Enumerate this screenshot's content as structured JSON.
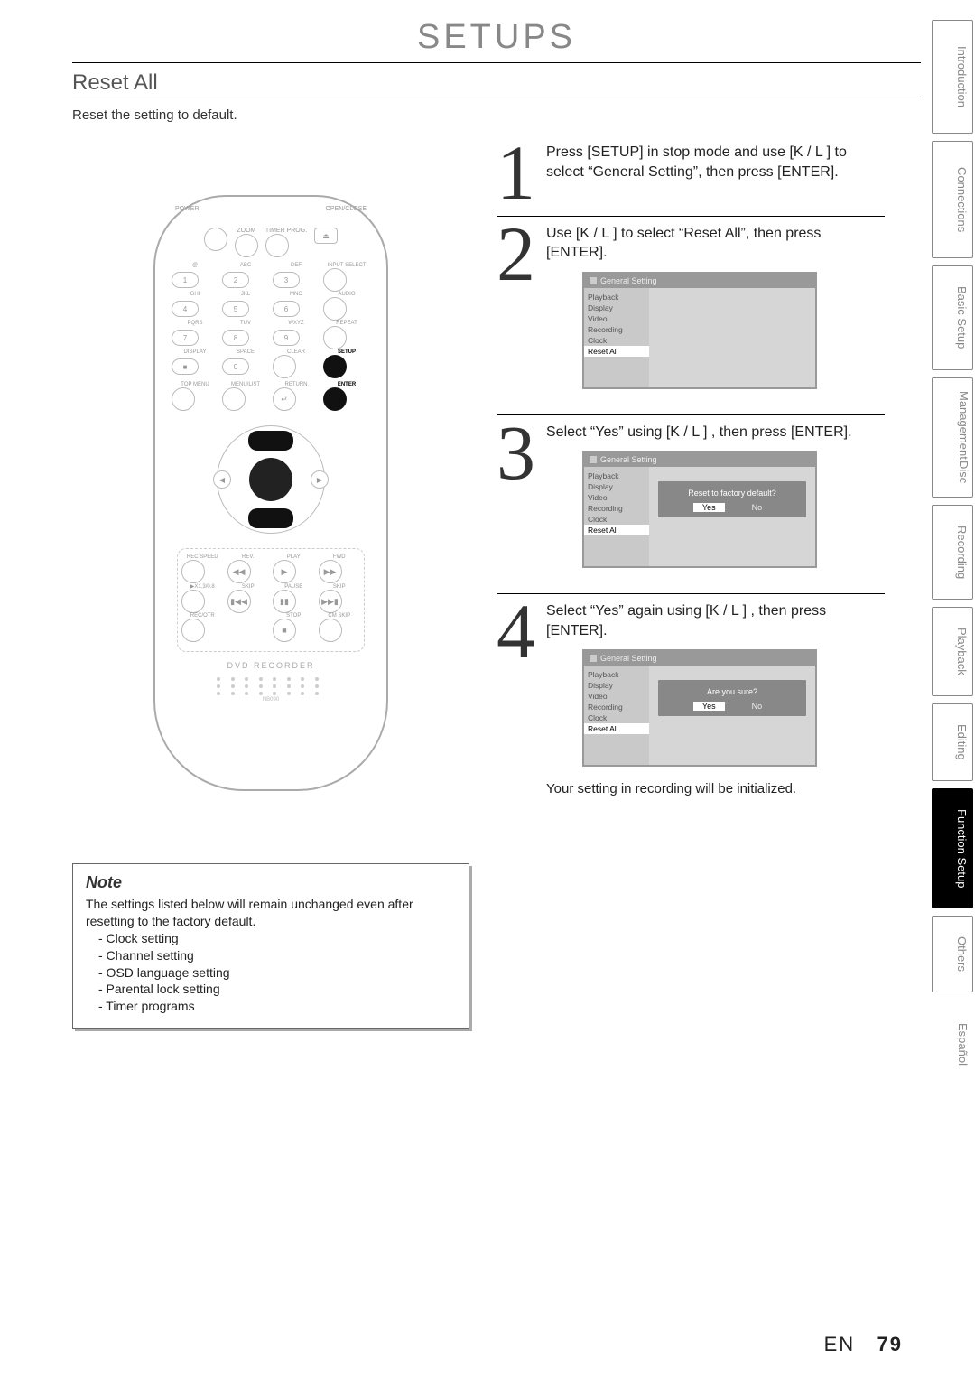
{
  "header": {
    "section_title": "SETUPS",
    "subheading": "Reset All",
    "intro": "Reset the setting to default."
  },
  "remote": {
    "top_left": "POWER",
    "top_right": "OPEN/CLOSE",
    "zoom": "ZOOM",
    "timer_prog": "TIMER PROG.",
    "eject_sym": "⏏",
    "row_labels_1": [
      "@",
      "ABC",
      "DEF",
      "INPUT SELECT"
    ],
    "nums_1": [
      "1",
      "2",
      "3"
    ],
    "row_labels_2": [
      "GHI",
      "JKL",
      "MNO",
      "AUDIO"
    ],
    "nums_2": [
      "4",
      "5",
      "6"
    ],
    "row_labels_3": [
      "PQRS",
      "TUV",
      "WXYZ",
      "REPEAT"
    ],
    "nums_3": [
      "7",
      "8",
      "9"
    ],
    "row_labels_4": [
      "DISPLAY",
      "SPACE",
      "CLEAR",
      "SETUP"
    ],
    "row4_symbols": [
      "■",
      "0",
      "",
      ""
    ],
    "row_labels_5": [
      "TOP MENU",
      "MENU/LIST",
      "RETURN",
      "ENTER"
    ],
    "return_sym": "↵",
    "lower": {
      "row1_labels": [
        "REC SPEED",
        "REV.",
        "PLAY",
        "FWD"
      ],
      "row1_syms": [
        "",
        "◀◀",
        "▶",
        "▶▶"
      ],
      "row2_labels": [
        "▶X1.3/0.8",
        "SKIP",
        "PAUSE",
        "SKIP"
      ],
      "row2_syms": [
        "",
        "▮◀◀",
        "▮▮",
        "▶▶▮"
      ],
      "row3_labels": [
        "REC/OTR",
        "",
        "STOP",
        "CM SKIP"
      ],
      "row3_syms": [
        "",
        "",
        "■",
        ""
      ]
    },
    "brand": "DVD RECORDER",
    "model": "NB090"
  },
  "steps": {
    "s1": {
      "num": "1",
      "text": "Press [SETUP] in stop mode and use [K / L ] to select “General Setting”, then press [ENTER]."
    },
    "s2": {
      "num": "2",
      "text": "Use [K / L ] to select “Reset All”, then press [ENTER]."
    },
    "s3": {
      "num": "3",
      "text": "Select “Yes” using [K / L ] , then press [ENTER]."
    },
    "s4": {
      "num": "4",
      "text": "Select “Yes” again using [K / L ] , then press [ENTER].",
      "after": "Your setting in recording will be initialized."
    }
  },
  "osd": {
    "title": "General Setting",
    "menu": [
      "Playback",
      "Display",
      "Video",
      "Recording",
      "Clock",
      "Reset All"
    ],
    "dialog1": {
      "question": "Reset to factory default?",
      "yes": "Yes",
      "no": "No"
    },
    "dialog2": {
      "question": "Are you sure?",
      "yes": "Yes",
      "no": "No"
    }
  },
  "note": {
    "title": "Note",
    "lead": "The settings listed below will remain unchanged even after resetting to the factory default.",
    "items": [
      "- Clock setting",
      "- Channel setting",
      "- OSD language setting",
      "- Parental lock setting",
      "- Timer programs"
    ]
  },
  "tabs": {
    "intro": "Introduction",
    "conn": "Connections",
    "basic": "Basic Setup",
    "disc": "Disc",
    "mgmt": "Management",
    "rec": "Recording",
    "play": "Playback",
    "edit": "Editing",
    "func": "Function Setup",
    "others": "Others",
    "esp": "Español"
  },
  "footer": {
    "lang": "EN",
    "page": "79"
  }
}
